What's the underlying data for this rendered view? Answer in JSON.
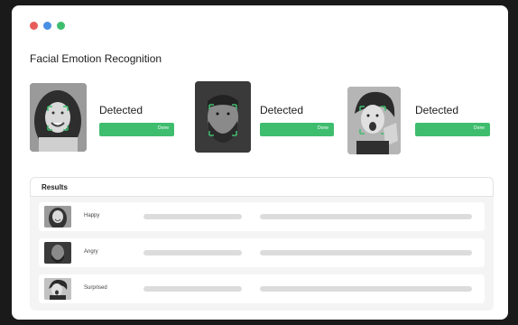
{
  "window": {
    "controls": [
      {
        "name": "close",
        "color": "#e85c5c"
      },
      {
        "name": "minimize",
        "color": "#4a90e2"
      },
      {
        "name": "maximize",
        "color": "#3fbd6e"
      }
    ],
    "title": "Facial Emotion Recognition"
  },
  "accent_color": "#3fbd6e",
  "detections": [
    {
      "label": "Detected",
      "button": "Done",
      "face_icon": "smiling-woman-photo"
    },
    {
      "label": "Detected",
      "button": "Done",
      "face_icon": "bearded-man-photo"
    },
    {
      "label": "Detected",
      "button": "Done",
      "face_icon": "surprised-woman-photo"
    }
  ],
  "results": {
    "header": "Results",
    "rows": [
      {
        "emotion": "Happy"
      },
      {
        "emotion": "Angry"
      },
      {
        "emotion": "Surprised"
      }
    ]
  }
}
